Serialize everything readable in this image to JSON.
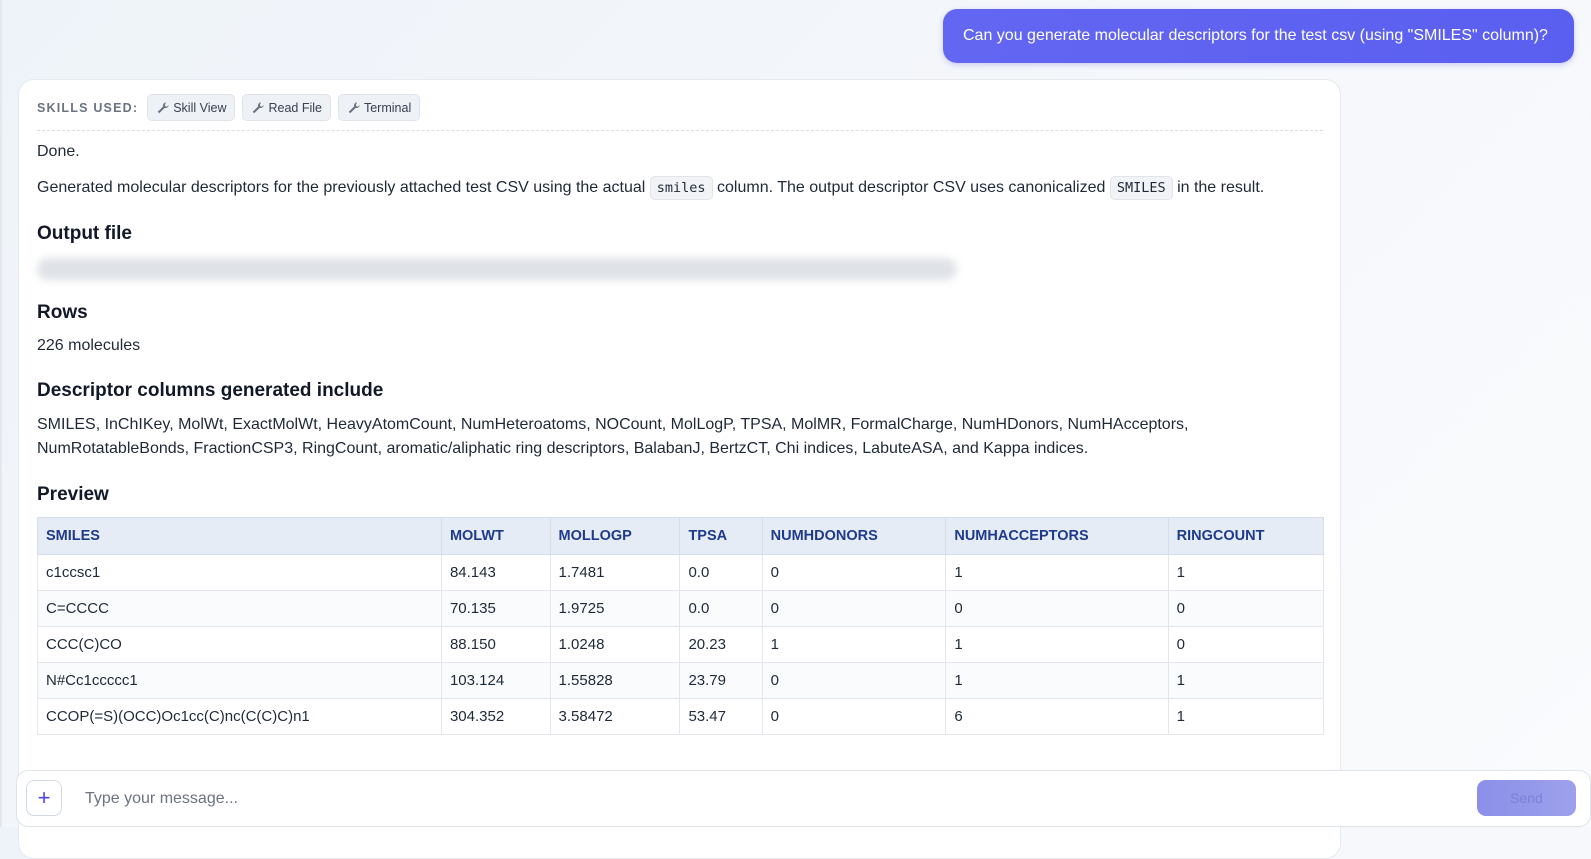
{
  "user_message": "Can you generate molecular descriptors for the test csv (using \"SMILES\" column)?",
  "skills": {
    "label": "SKILLS USED:",
    "items": [
      "Skill View",
      "Read File",
      "Terminal"
    ]
  },
  "response": {
    "done": "Done.",
    "summary": {
      "part1": "Generated molecular descriptors for the previously attached test CSV using the actual",
      "code1": "smiles",
      "part2": "column. The output descriptor CSV uses canonicalized",
      "code2": "SMILES",
      "part3": "in the result."
    },
    "output_heading": "Output file",
    "rows_heading": "Rows",
    "rows_value": "226 molecules",
    "descriptors_heading": "Descriptor columns generated include",
    "descriptors_line1": "SMILES, InChIKey, MolWt, ExactMolWt, HeavyAtomCount, NumHeteroatoms, NOCount, MolLogP, TPSA, MolMR, FormalCharge, NumHDonors, NumHAcceptors,",
    "descriptors_line2": "NumRotatableBonds, FractionCSP3, RingCount, aromatic/aliphatic ring descriptors, BalabanJ, BertzCT, Chi indices, LabuteASA, and Kappa indices.",
    "preview_heading": "Preview"
  },
  "preview_table": {
    "headers": [
      "SMILES",
      "MOLWT",
      "MOLLOGP",
      "TPSA",
      "NUMHDONORS",
      "NUMHACCEPTORS",
      "RINGCOUNT"
    ],
    "rows": [
      [
        "c1ccsc1",
        "84.143",
        "1.7481",
        "0.0",
        "0",
        "1",
        "1"
      ],
      [
        "C=CCCC",
        "70.135",
        "1.9725",
        "0.0",
        "0",
        "0",
        "0"
      ],
      [
        "CCC(C)CO",
        "88.150",
        "1.0248",
        "20.23",
        "1",
        "1",
        "0"
      ],
      [
        "N#Cc1ccccc1",
        "103.124",
        "1.55828",
        "23.79",
        "0",
        "1",
        "1"
      ],
      [
        "CCOP(=S)(OCC)Oc1cc(C)nc(C(C)C)n1",
        "304.352",
        "3.58472",
        "53.47",
        "0",
        "6",
        "1"
      ]
    ]
  },
  "composer": {
    "placeholder": "Type your message...",
    "plus_label": "+",
    "send_label": "Send"
  },
  "colors": {
    "accent": "#6366f1",
    "table_header_bg": "#e6ecf6",
    "table_header_text": "#1e3a8a"
  }
}
